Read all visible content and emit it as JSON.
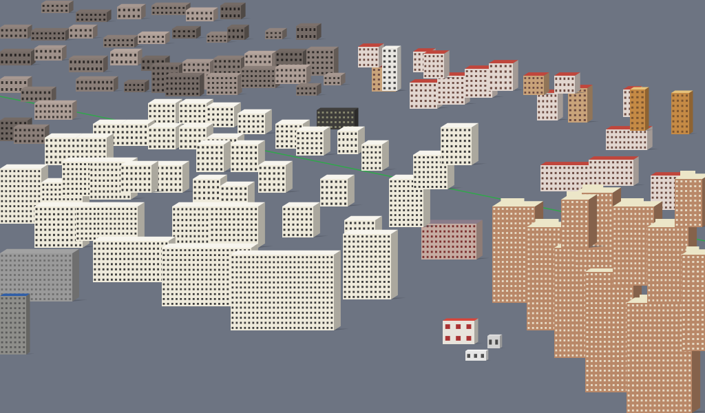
{
  "viewport": {
    "kind": "3d-city-model-render",
    "ground_color": "#6d7482",
    "axis_line_color": "#2fa84a",
    "shadow_color": "#4c525c"
  },
  "districts": [
    {
      "name": "white-midrise-residential-blocks",
      "building_color": "#eeeadb",
      "count": 38
    },
    {
      "name": "highrise-brick-towers",
      "building_color": "#b98868",
      "count": 11
    },
    {
      "name": "red-roof-terrace-rows",
      "building_color": "#e2d6cf",
      "count": 12
    },
    {
      "name": "dense-lowrise-far-blocks",
      "building_color": "#8a7e78",
      "count": 40
    },
    {
      "name": "gray-blocks-left-edge",
      "building_color": "#9a9a9a",
      "count": 2
    },
    {
      "name": "gate-kiosk",
      "building_color": "#d8463c",
      "count": 1
    }
  ]
}
